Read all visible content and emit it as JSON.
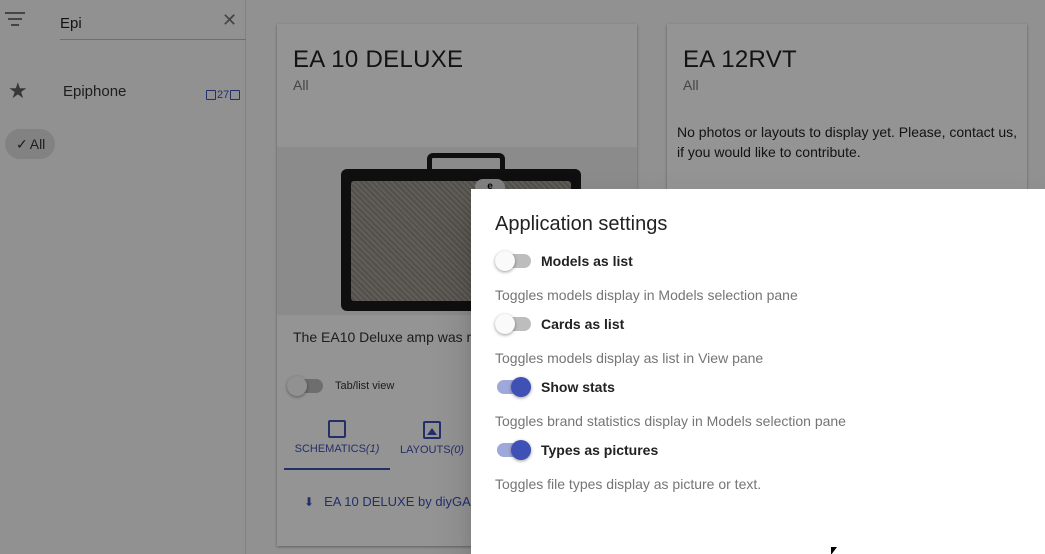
{
  "sidebar": {
    "search_value": "Epi",
    "brand": {
      "name": "Epiphone",
      "count": "27"
    },
    "chip_label": "All"
  },
  "cards": [
    {
      "title": "EA 10 DELUXE",
      "subtitle": "All",
      "description": "The EA10 Deluxe amp was m",
      "tab_list_label": "Tab/list view",
      "tabs": [
        {
          "label": "SCHEMATICS",
          "count": "(1)"
        },
        {
          "label": "LAYOUTS",
          "count": "(0)"
        }
      ],
      "download_label": "EA 10 DELUXE by diyGA"
    },
    {
      "title": "EA 12RVT",
      "subtitle": "All",
      "empty_text": "No photos or layouts to display yet. Please, contact us, if you would like to contribute."
    }
  ],
  "dialog": {
    "title": "Application settings",
    "settings": [
      {
        "label": "Models as list",
        "help": "Toggles models display in Models selection pane",
        "enabled": false
      },
      {
        "label": "Cards as list",
        "help": "Toggles models display as list in View pane",
        "enabled": false
      },
      {
        "label": "Show stats",
        "help": "Toggles brand statistics display in Models selection pane",
        "enabled": true
      },
      {
        "label": "Types as pictures",
        "help": "Toggles file types display as picture or text.",
        "enabled": true
      }
    ]
  },
  "colors": {
    "accent": "#3f51b5",
    "accent_light": "#9fa8da",
    "overlay": "rgba(0,0,0,0.42)"
  },
  "icons": {
    "filter": "filter-icon",
    "clear": "close-icon",
    "brand": "star-icon",
    "chip_check": "check-icon",
    "tab_schematics": "schematic-icon",
    "tab_layouts": "image-icon",
    "download": "download-icon"
  }
}
